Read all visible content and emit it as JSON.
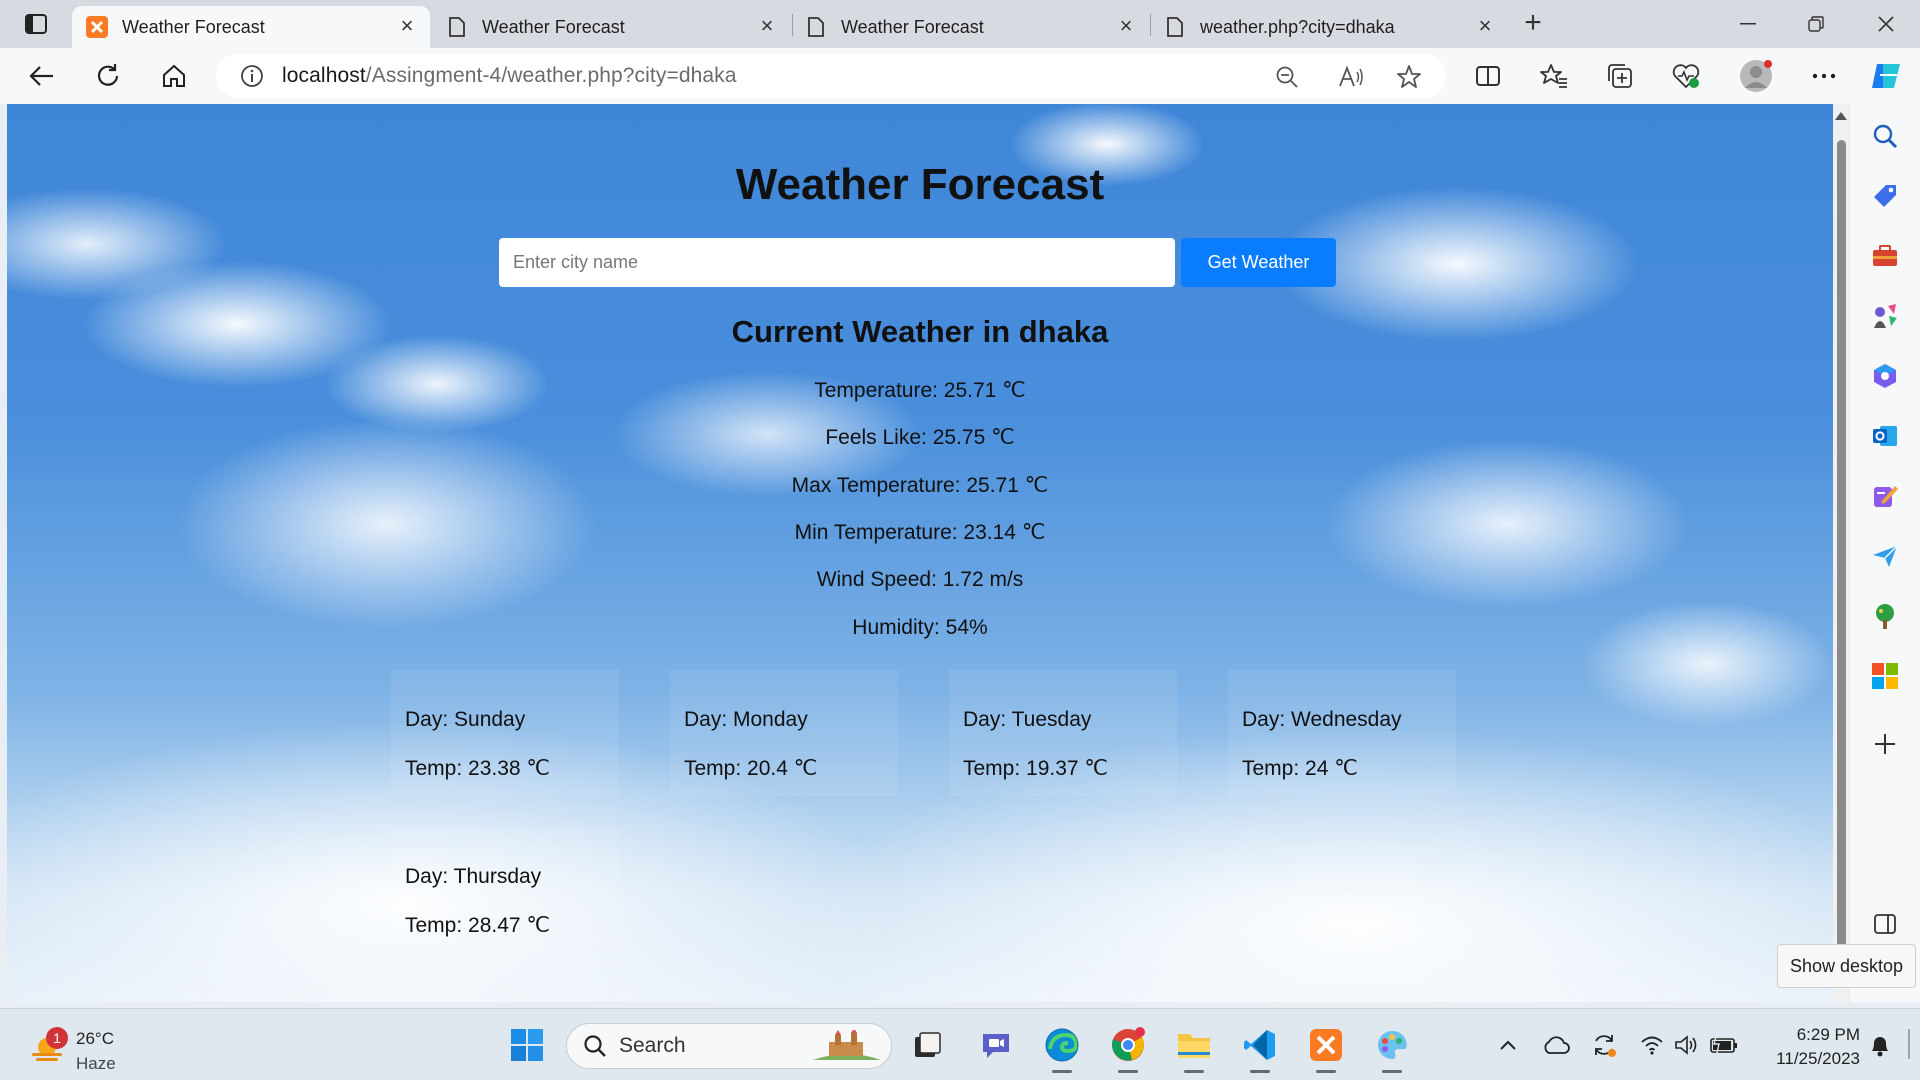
{
  "browser": {
    "tabs": [
      {
        "title": "Weather Forecast",
        "active": true,
        "favicon": "xampp-icon"
      },
      {
        "title": "Weather Forecast",
        "active": false,
        "favicon": "page-icon"
      },
      {
        "title": "Weather Forecast",
        "active": false,
        "favicon": "page-icon"
      },
      {
        "title": "weather.php?city=dhaka",
        "active": false,
        "favicon": "page-icon"
      }
    ],
    "address": {
      "host": "localhost",
      "path": "/Assingment-4/weather.php?city=dhaka"
    }
  },
  "page": {
    "title": "Weather Forecast",
    "search": {
      "placeholder": "Enter city name",
      "button_label": "Get Weather"
    },
    "current_heading": "Current Weather in dhaka",
    "stats": [
      "Temperature: 25.71 ℃",
      "Feels Like: 25.75 ℃",
      "Max Temperature: 25.71 ℃",
      "Min Temperature: 23.14 ℃",
      "Wind Speed: 1.72 m/s",
      "Humidity: 54%"
    ],
    "forecast": [
      {
        "day": "Day: Sunday",
        "temp": "Temp: 23.38 ℃"
      },
      {
        "day": "Day: Monday",
        "temp": "Temp: 20.4 ℃"
      },
      {
        "day": "Day: Tuesday",
        "temp": "Temp: 19.37 ℃"
      },
      {
        "day": "Day: Wednesday",
        "temp": "Temp: 24 ℃"
      },
      {
        "day": "Day: Thursday",
        "temp": "Temp: 28.47 ℃"
      }
    ]
  },
  "tooltip": {
    "show_desktop": "Show desktop"
  },
  "taskbar": {
    "weather": {
      "temp": "26°C",
      "condition": "Haze",
      "badge": "1"
    },
    "search_label": "Search",
    "clock": {
      "time": "6:29 PM",
      "date": "11/25/2023"
    }
  },
  "colors": {
    "accent": "#0a7cff",
    "sky": "#4a8fdc"
  }
}
